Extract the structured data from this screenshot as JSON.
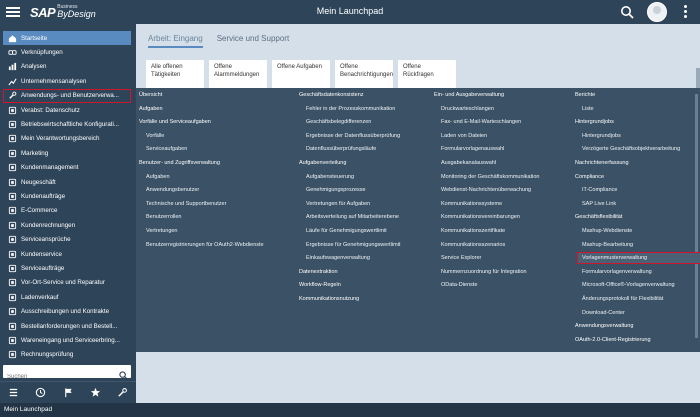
{
  "shell": {
    "logo_sap": "SAP",
    "logo_business": "Business",
    "logo_product": "ByDesign",
    "title": "Mein Launchpad"
  },
  "sidebar": {
    "items": [
      {
        "label": "Startseite",
        "icon": "home-icon"
      },
      {
        "label": "Verknüpfungen",
        "icon": "link-icon"
      },
      {
        "label": "Analysen",
        "icon": "analytics-icon"
      },
      {
        "label": "Unternehmensanalysen",
        "icon": "chart-icon"
      },
      {
        "label": "Anwendungs- und Benutzerverwa...",
        "icon": "wrench-icon"
      },
      {
        "label": "Verabst: Datenschutz",
        "icon": "person-icon"
      },
      {
        "label": "Betriebswirtschaftliche Konfigurati...",
        "icon": "config-icon"
      },
      {
        "label": "Mein Verantwortungsbereich",
        "icon": "area-icon"
      },
      {
        "label": "Marketing",
        "icon": "marketing-icon"
      },
      {
        "label": "Kundenmanagement",
        "icon": "customer-icon"
      },
      {
        "label": "Neugeschäft",
        "icon": "business-icon"
      },
      {
        "label": "Kundenaufträge",
        "icon": "order-icon"
      },
      {
        "label": "E-Commerce",
        "icon": "ecommerce-icon"
      },
      {
        "label": "Kundenrechnungen",
        "icon": "invoice-icon"
      },
      {
        "label": "Serviceansprüche",
        "icon": "service-icon"
      },
      {
        "label": "Kundenservice",
        "icon": "support-icon"
      },
      {
        "label": "Serviceaufträge",
        "icon": "service-order-icon"
      },
      {
        "label": "Vor-Ort-Service und Reparatur",
        "icon": "repair-icon"
      },
      {
        "label": "Ladenverkauf",
        "icon": "store-icon"
      },
      {
        "label": "Ausschreibungen und Kontrakte",
        "icon": "contract-icon"
      },
      {
        "label": "Bestellanforderungen und Bestell...",
        "icon": "purchase-icon"
      },
      {
        "label": "Wareneingang und Serviceerbring...",
        "icon": "goods-icon"
      },
      {
        "label": "Rechnungsprüfung",
        "icon": "check-icon"
      }
    ],
    "search_placeholder": "Suchen"
  },
  "tabs": [
    {
      "label": "Arbeit: Eingang"
    },
    {
      "label": "Service und Support"
    }
  ],
  "tiles": [
    {
      "label": "Alle offenen Tätigkeiten"
    },
    {
      "label": "Offene Alarmmeldungen"
    },
    {
      "label": "Offene Aufgaben"
    },
    {
      "label": "Offene Benachrichtigungen"
    },
    {
      "label": "Offene Rückfragen"
    }
  ],
  "mega": {
    "col1": [
      {
        "label": "Übersicht",
        "sub": false
      },
      {
        "label": "Aufgaben",
        "sub": false
      },
      {
        "label": "Vorfälle und Serviceaufgaben",
        "sub": false
      },
      {
        "label": "Vorfälle",
        "sub": true
      },
      {
        "label": "Serviceaufgaben",
        "sub": true
      },
      {
        "label": "Benutzer- und Zugriffsverwaltung",
        "sub": false
      },
      {
        "label": "Aufgaben",
        "sub": true
      },
      {
        "label": "Anwendungsbenutzer",
        "sub": true
      },
      {
        "label": "Technische und Supportbenutzer",
        "sub": true
      },
      {
        "label": "Benutzerrollen",
        "sub": true
      },
      {
        "label": "Vertretungen",
        "sub": true
      },
      {
        "label": "Benutzerregistrierungen für OAuth2-Webdienste",
        "sub": true
      }
    ],
    "col2": [
      {
        "label": "Geschäftsdatenkonsistenz",
        "sub": false
      },
      {
        "label": "Fehler in der Prozesskommunikation",
        "sub": true
      },
      {
        "label": "Geschäftsbelegdifferenzen",
        "sub": true
      },
      {
        "label": "Ergebnisse der Datenflussüberprüfung",
        "sub": true
      },
      {
        "label": "Datenflussüberprüfungsläufe",
        "sub": true
      },
      {
        "label": "Aufgabenverteilung",
        "sub": false
      },
      {
        "label": "Aufgabensteuerung",
        "sub": true
      },
      {
        "label": "Genehmigungsprozesse",
        "sub": true
      },
      {
        "label": "Vertretungen für Aufgaben",
        "sub": true
      },
      {
        "label": "Arbeitsverteilung auf Mitarbeiterebene",
        "sub": true
      },
      {
        "label": "Läufe für Genehmigungswertlimit",
        "sub": true
      },
      {
        "label": "Ergebnisse für Genehmigungswertlimit",
        "sub": true
      },
      {
        "label": "Einkaufswagenverwaltung",
        "sub": true
      },
      {
        "label": "Datenextraktion",
        "sub": false
      },
      {
        "label": "Workflow-Regeln",
        "sub": false
      },
      {
        "label": "Kommunikationsnutzung",
        "sub": false
      }
    ],
    "col3": [
      {
        "label": "Ein- und Ausgabeverwaltung",
        "sub": false
      },
      {
        "label": "Druckwarteschlangen",
        "sub": true
      },
      {
        "label": "Fax- und E-Mail-Warteschlangen",
        "sub": true
      },
      {
        "label": "Laden von Dateien",
        "sub": true
      },
      {
        "label": "Formularvorlagenauswahl",
        "sub": true
      },
      {
        "label": "Ausgabekanalauswahl",
        "sub": true
      },
      {
        "label": "Monitoring der Geschäftskommunikation",
        "sub": true
      },
      {
        "label": "Webdienst-Nachrichtenüberwachung",
        "sub": true
      },
      {
        "label": "Kommunikationssysteme",
        "sub": true
      },
      {
        "label": "Kommunikationsvereinbarungen",
        "sub": true
      },
      {
        "label": "Kommunikationszertifikate",
        "sub": true
      },
      {
        "label": "Kommunikationsszenarios",
        "sub": true
      },
      {
        "label": "Service Explorer",
        "sub": true
      },
      {
        "label": "Nummernzuordnung für Integration",
        "sub": true
      },
      {
        "label": "OData-Dienste",
        "sub": true
      }
    ],
    "col4": [
      {
        "label": "Berichte",
        "sub": false
      },
      {
        "label": "Liste",
        "sub": true
      },
      {
        "label": "Hintergrundjobs",
        "sub": false
      },
      {
        "label": "Hintergrundjobs",
        "sub": true
      },
      {
        "label": "Verzögerte Geschäftsobjektverarbeitung",
        "sub": true
      },
      {
        "label": "Nachrichtenerfassung",
        "sub": false
      },
      {
        "label": "Compliance",
        "sub": false
      },
      {
        "label": "IT-Compliance",
        "sub": true
      },
      {
        "label": "SAP Live Link",
        "sub": true
      },
      {
        "label": "Geschäftsflexibilität",
        "sub": false
      },
      {
        "label": "Mashup-Webdienste",
        "sub": true
      },
      {
        "label": "Mashup-Bearbeitung",
        "sub": true
      },
      {
        "label": "Vorlagenmusterverwaltung",
        "sub": true,
        "highlight": true
      },
      {
        "label": "Formularvorlagenverwaltung",
        "sub": true
      },
      {
        "label": "Microsoft-Office®-Vorlagenverwaltung",
        "sub": true
      },
      {
        "label": "Änderungsprotokoll für Flexibilität",
        "sub": true
      },
      {
        "label": "Download-Center",
        "sub": true
      },
      {
        "label": "Anwendungsverwaltung",
        "sub": false
      },
      {
        "label": "OAuth-2.0-Client-Registrierung",
        "sub": false
      }
    ]
  },
  "statusbar": {
    "text": "Mein Launchpad"
  },
  "colors": {
    "shell": "#2e4459",
    "active": "#5a8bc0",
    "highlight_border": "#d0152d",
    "mega_bg": "#3b5266"
  }
}
